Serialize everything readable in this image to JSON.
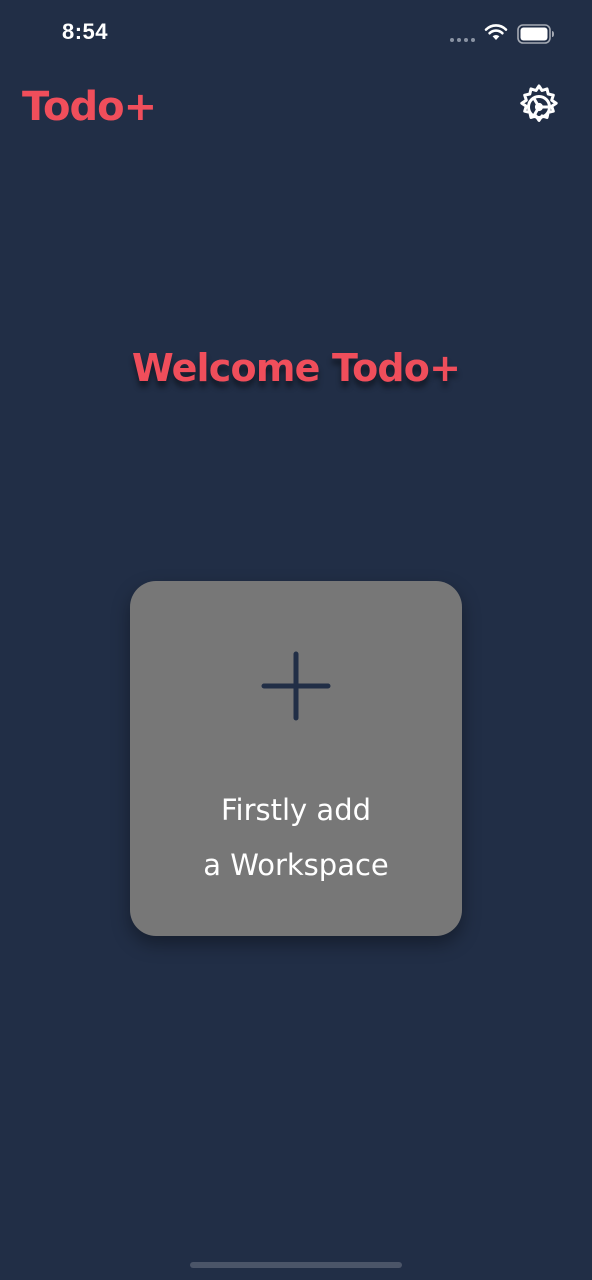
{
  "status_bar": {
    "time": "8:54",
    "icons": [
      "signal-dots-icon",
      "wifi-icon",
      "battery-icon"
    ]
  },
  "header": {
    "title": "Todo+",
    "settings_icon": "gear-icon"
  },
  "main": {
    "welcome_title": "Welcome Todo+",
    "add_card": {
      "icon": "plus-icon",
      "line1": "Firstly add",
      "line2": "a Workspace"
    }
  },
  "colors": {
    "background": "#212e46",
    "accent": "#f04e5b",
    "card": "#777777",
    "icon_dark": "#212e46",
    "text_light": "#ffffff"
  }
}
